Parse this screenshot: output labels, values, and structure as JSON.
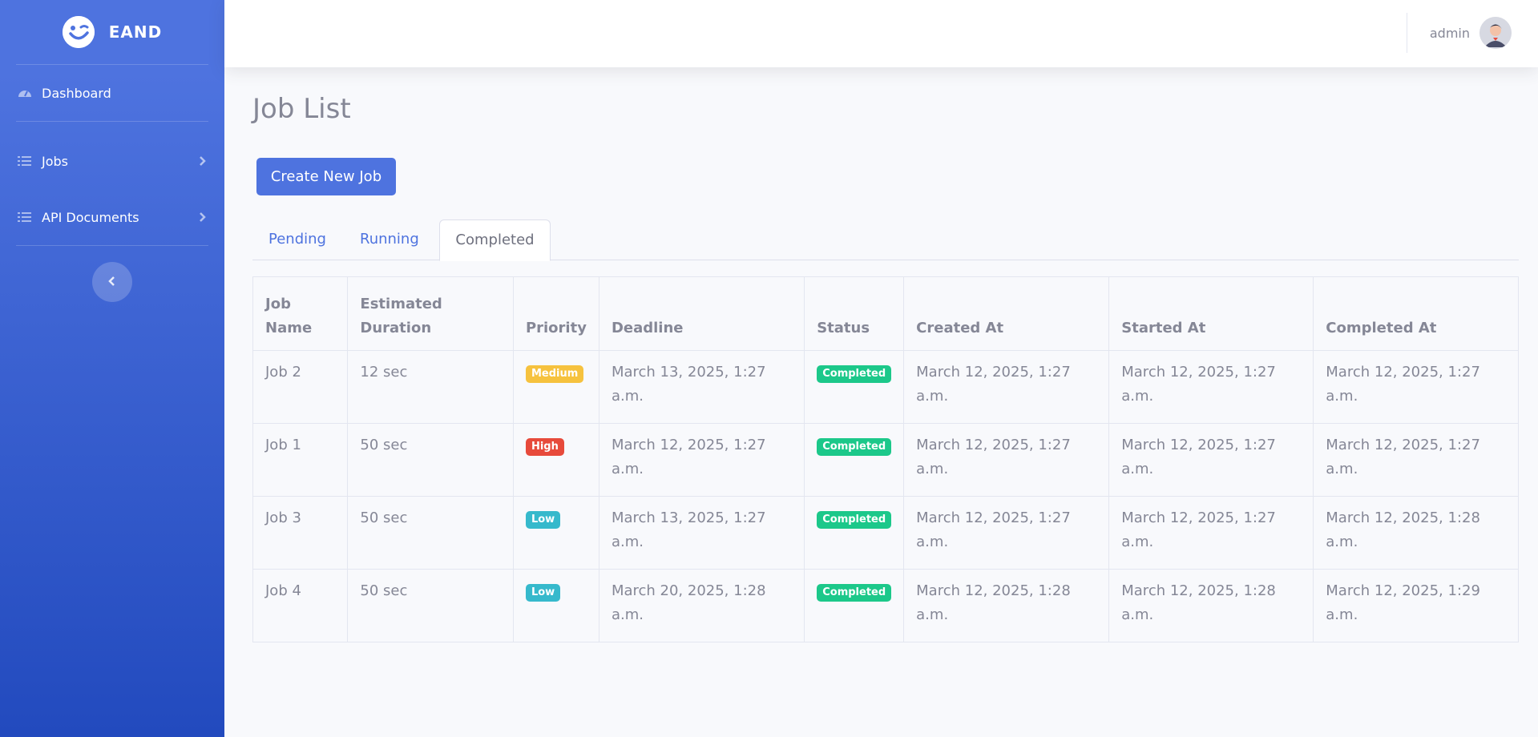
{
  "brand": {
    "name": "EAND"
  },
  "sidebar": {
    "items": [
      {
        "label": "Dashboard",
        "icon": "tachometer-icon"
      },
      {
        "label": "Jobs",
        "icon": "list-icon"
      },
      {
        "label": "API Documents",
        "icon": "list-icon"
      }
    ]
  },
  "topbar": {
    "user_name": "admin"
  },
  "page": {
    "title": "Job List",
    "create_button": "Create New Job",
    "tabs": [
      {
        "label": "Pending",
        "active": false
      },
      {
        "label": "Running",
        "active": false
      },
      {
        "label": "Completed",
        "active": true
      }
    ]
  },
  "table": {
    "headers": [
      "Job Name",
      "Estimated Duration",
      "Priority",
      "Deadline",
      "Status",
      "Created At",
      "Started At",
      "Completed At"
    ],
    "rows": [
      {
        "name": "Job 2",
        "duration": "12 sec",
        "priority": "Medium",
        "deadline": "March 13, 2025, 1:27 a.m.",
        "status": "Completed",
        "created": "March 12, 2025, 1:27 a.m.",
        "started": "March 12, 2025, 1:27 a.m.",
        "completed": "March 12, 2025, 1:27 a.m."
      },
      {
        "name": "Job 1",
        "duration": "50 sec",
        "priority": "High",
        "deadline": "March 12, 2025, 1:27 a.m.",
        "status": "Completed",
        "created": "March 12, 2025, 1:27 a.m.",
        "started": "March 12, 2025, 1:27 a.m.",
        "completed": "March 12, 2025, 1:27 a.m."
      },
      {
        "name": "Job 3",
        "duration": "50 sec",
        "priority": "Low",
        "deadline": "March 13, 2025, 1:27 a.m.",
        "status": "Completed",
        "created": "March 12, 2025, 1:27 a.m.",
        "started": "March 12, 2025, 1:27 a.m.",
        "completed": "March 12, 2025, 1:28 a.m."
      },
      {
        "name": "Job 4",
        "duration": "50 sec",
        "priority": "Low",
        "deadline": "March 20, 2025, 1:28 a.m.",
        "status": "Completed",
        "created": "March 12, 2025, 1:28 a.m.",
        "started": "March 12, 2025, 1:28 a.m.",
        "completed": "March 12, 2025, 1:29 a.m."
      }
    ]
  },
  "colors": {
    "primary": "#4e73df",
    "medium": "#f6c23e",
    "high": "#e74a3b",
    "low": "#36b9cc",
    "completed": "#1cc88a"
  }
}
